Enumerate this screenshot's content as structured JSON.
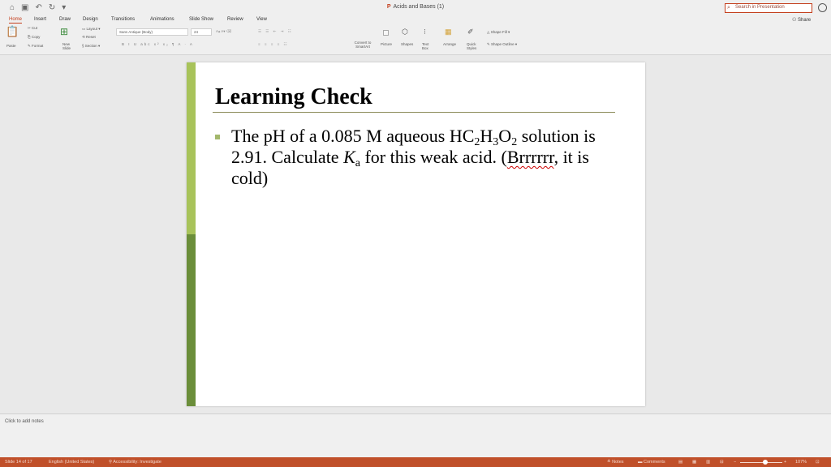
{
  "window": {
    "title": "Acids and Bases (1)"
  },
  "search": {
    "placeholder": "Search in Presentation"
  },
  "tabs": [
    "Home",
    "Insert",
    "Draw",
    "Design",
    "Transitions",
    "Animations",
    "Slide Show",
    "Review",
    "View"
  ],
  "share_label": "Share",
  "ribbon": {
    "paste": "Paste",
    "cut": "Cut",
    "copy": "Copy",
    "format": "Format",
    "new_slide": "New Slide",
    "layout": "Layout",
    "reset": "Reset",
    "section": "Section",
    "font_name": "Sans Antique (Body)",
    "font_size": "24",
    "convert_smartart": "Convert to SmartArt",
    "picture": "Picture",
    "shapes": "Shapes",
    "text_box": "Text Box",
    "arrange": "Arrange",
    "quick_styles": "Quick Styles",
    "shape_fill": "Shape Fill",
    "shape_outline": "Shape Outline"
  },
  "slide": {
    "title": "Learning Check",
    "body": {
      "p1": "The pH of a 0.085 M aqueous HC",
      "s1": "2",
      "p2": "H",
      "s2": "3",
      "p3": "O",
      "s3": "2",
      "p4": " solution is 2.91. Calculate ",
      "k": "K",
      "ka_sub": "a",
      "p5": " for this weak acid. (",
      "brr": "Brrrrrr",
      "p6": ", it is cold)"
    },
    "colors": {
      "bar_light": "#a8c35a",
      "bar_dark": "#6b8e3a"
    }
  },
  "notes": {
    "placeholder": "Click to add notes"
  },
  "status": {
    "slide_info": "Slide 14 of 17",
    "language": "English (United States)",
    "accessibility": "Accessibility: Investigate",
    "notes_btn": "Notes",
    "comments_btn": "Comments",
    "zoom": "107%"
  },
  "accent_color": "#c43e1c"
}
